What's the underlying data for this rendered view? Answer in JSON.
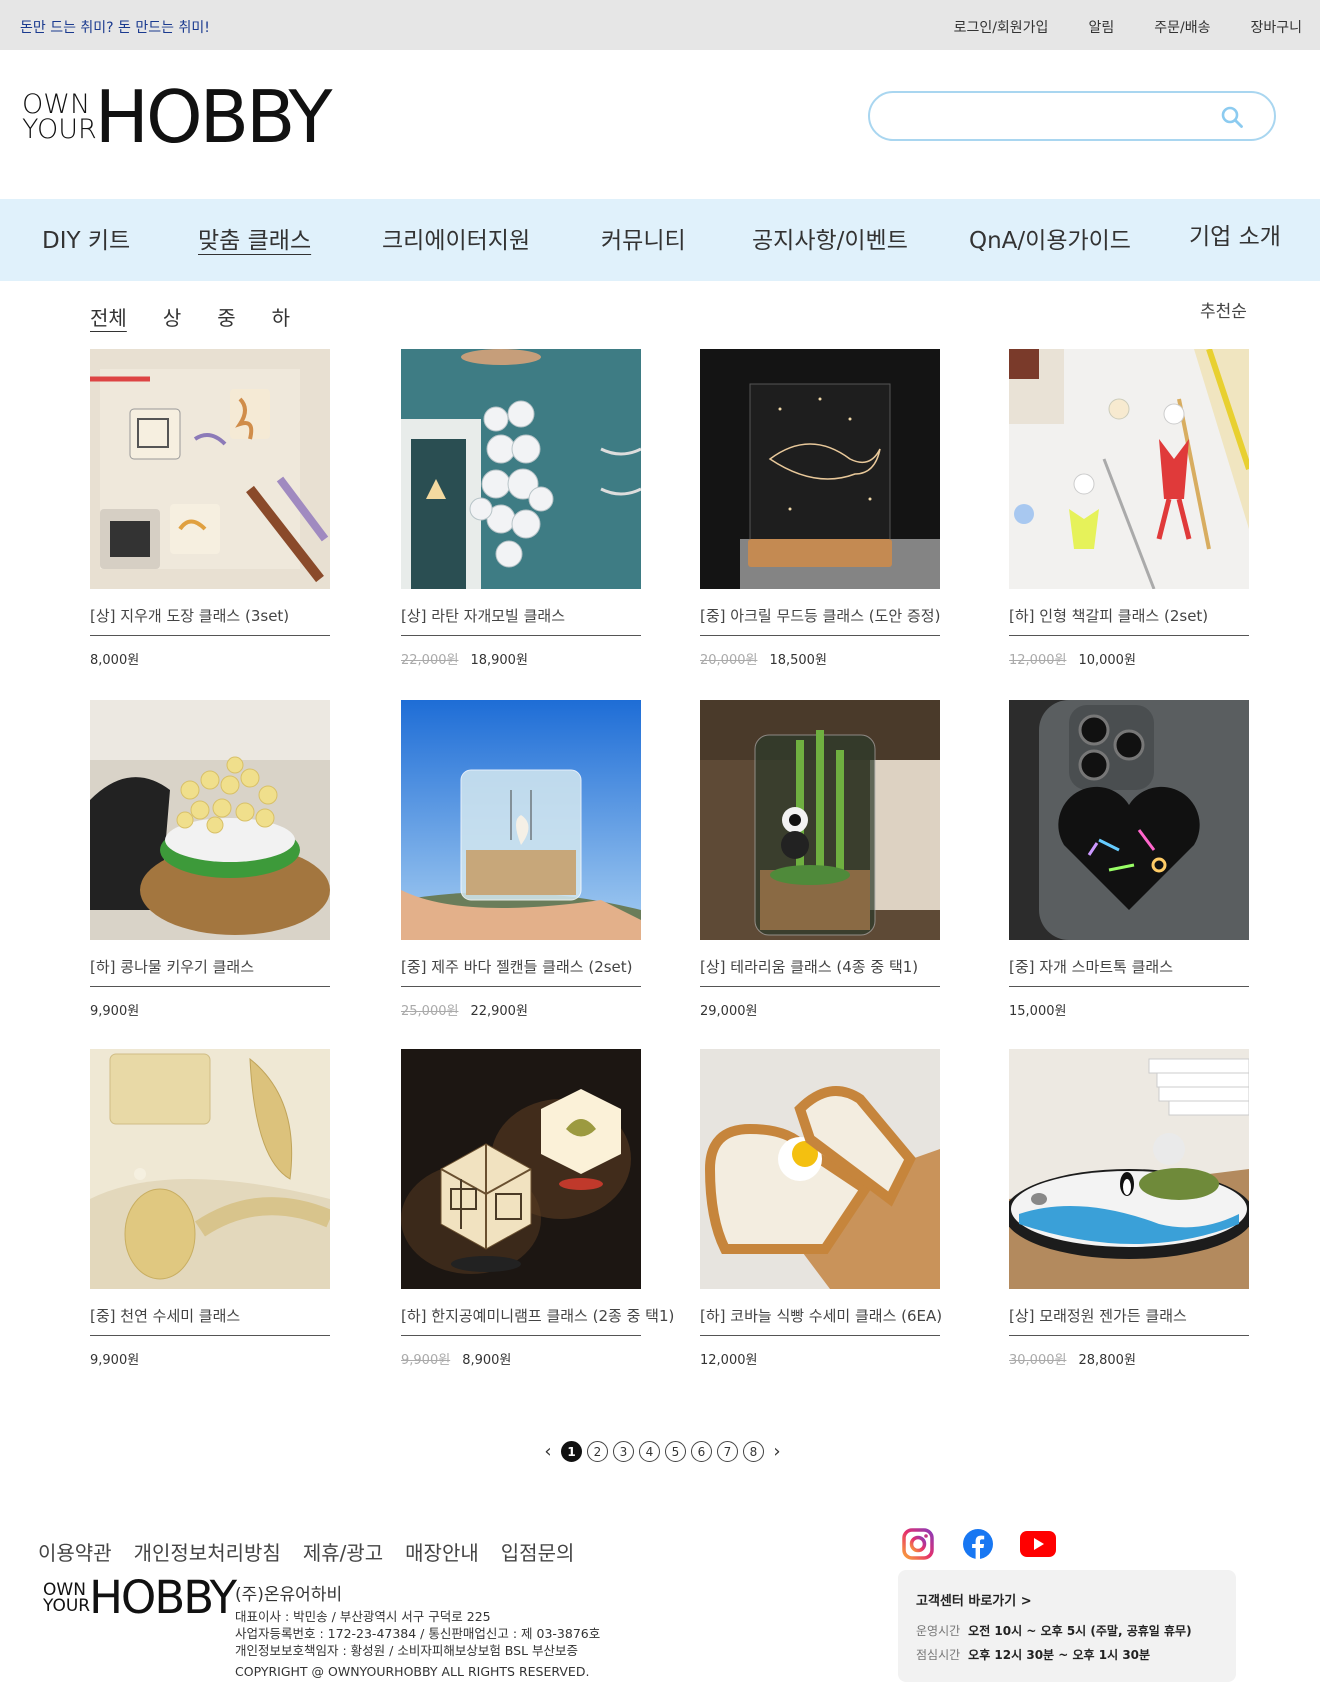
{
  "topbar": {
    "slogan": "돈만 드는 취미?  돈 만드는 취미!",
    "links": [
      "로그인/회원가입",
      "알림",
      "주문/배송",
      "장바구니"
    ]
  },
  "logo": {
    "small_top": "OWN",
    "small_bottom": "YOUR",
    "big": "HOBBY"
  },
  "search": {
    "value": "",
    "placeholder": ""
  },
  "nav": [
    "DIY 키트",
    "맞춤 클래스",
    "크리에이터지원",
    "커뮤니티",
    "공지사항/이벤트",
    "QnA/이용가이드",
    "기업 소개"
  ],
  "filters": [
    "전체",
    "상",
    "중",
    "하"
  ],
  "sort": "추천순",
  "products": [
    {
      "name": "[상] 지우개 도장 클래스 (3set)",
      "old_price": "",
      "price": "8,000원"
    },
    {
      "name": "[상] 라탄 자개모빌 클래스",
      "old_price": "22,000원",
      "price": "18,900원"
    },
    {
      "name": "[중] 아크릴 무드등 클래스 (도안 증정)",
      "old_price": "20,000원",
      "price": "18,500원"
    },
    {
      "name": "[하] 인형 책갈피 클래스 (2set)",
      "old_price": "12,000원",
      "price": "10,000원"
    },
    {
      "name": "[하] 콩나물 키우기 클래스",
      "old_price": "",
      "price": "9,900원"
    },
    {
      "name": "[중] 제주 바다 젤캔들 클래스 (2set)",
      "old_price": "25,000원",
      "price": "22,900원"
    },
    {
      "name": "[상] 테라리움 클래스 (4종 중 택1)",
      "old_price": "",
      "price": "29,000원"
    },
    {
      "name": "[중] 자개 스마트톡 클래스",
      "old_price": "",
      "price": "15,000원"
    },
    {
      "name": "[중] 천연 수세미 클래스",
      "old_price": "",
      "price": "9,900원"
    },
    {
      "name": "[하] 한지공예미니램프 클래스 (2종 중 택1)",
      "old_price": "9,900원",
      "price": "8,900원"
    },
    {
      "name": "[하] 코바늘 식빵 수세미 클래스 (6EA)",
      "old_price": "",
      "price": "12,000원"
    },
    {
      "name": "[상] 모래정원 젠가든 클래스",
      "old_price": "30,000원",
      "price": "28,800원"
    }
  ],
  "pagination": {
    "prev": "‹",
    "next": "›",
    "pages": [
      "1",
      "2",
      "3",
      "4",
      "5",
      "6",
      "7",
      "8"
    ],
    "current": "1"
  },
  "footer": {
    "links": [
      "이용약관",
      "개인정보처리방침",
      "제휴/광고",
      "매장안내",
      "입점문의"
    ],
    "company": "(주)온유어하비",
    "info_lines": [
      "대표이사 : 박민송 / 부산광역시 서구 구덕로 225",
      "사업자등록번호 : 172-23-47384 / 통신판매업신고 : 제 03-3876호",
      "개인정보보호책임자 : 황성원 / 소비자피해보상보험 BSL 부산보증"
    ],
    "copyright": "COPYRIGHT @ OWNYOURHOBBY ALL RIGHTS RESERVED.",
    "social": [
      "instagram-icon",
      "facebook-icon",
      "youtube-icon"
    ],
    "cs": {
      "title": "고객센터 바로가기 >",
      "hours_label": "운영시간",
      "hours": "오전 10시 ~ 오후 5시 (주말, 공휴일 휴무)",
      "lunch_label": "점심시간",
      "lunch": "오후 12시 30분 ~ 오후 1시 30분"
    }
  },
  "colors": {
    "topbar_bg": "#e6e6e6",
    "slogan": "#1a3a8f",
    "nav_bg": "#e0f1fb",
    "search_border": "#a9d6f0"
  }
}
